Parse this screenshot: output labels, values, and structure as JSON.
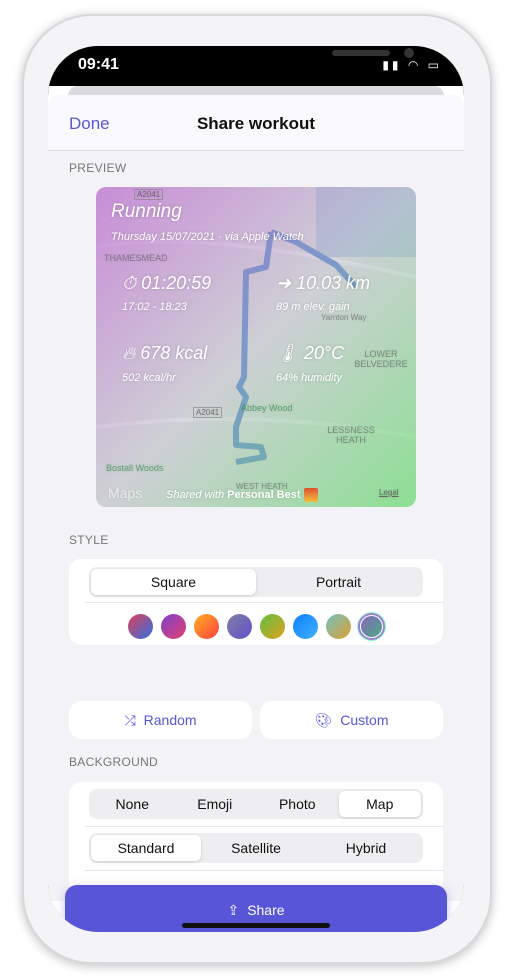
{
  "status": {
    "time": "09:41"
  },
  "nav": {
    "done": "Done",
    "title": "Share workout"
  },
  "sections": {
    "preview": "PREVIEW",
    "style": "STYLE",
    "background": "BACKGROUND"
  },
  "preview": {
    "activity": "Running",
    "subtitle": "Thursday 15/07/2021 · via Apple Watch",
    "duration": "01:20:59",
    "time_range": "17:02 - 18:23",
    "distance": "10.03 km",
    "elevation": "89 m elev. gain",
    "calories": "678 kcal",
    "cal_rate": "502 kcal/hr",
    "temperature": "20°C",
    "humidity": "64% humidity",
    "shared_prefix": "Shared with",
    "shared_app": "Personal Best",
    "maps": "Maps",
    "legal": "Legal",
    "map_labels": [
      "A2041",
      "THAMESMEAD",
      "Yarnton Way",
      "LOWER BELVEDERE",
      "Abbey Wood",
      "A2041",
      "LESSNESS HEATH",
      "Bostall Woods",
      "WEST HEATH"
    ]
  },
  "style": {
    "options": [
      "Square",
      "Portrait"
    ],
    "selected": "Square",
    "swatches": [
      [
        "#e0405a",
        "#3070e0"
      ],
      [
        "#8040d0",
        "#e04070"
      ],
      [
        "#ffb020",
        "#ff4040"
      ],
      [
        "#8080a0",
        "#6050d0"
      ],
      [
        "#60c040",
        "#e0a020"
      ],
      [
        "#1080ff",
        "#40b0ff"
      ],
      [
        "#70c0c0",
        "#e0a030"
      ],
      [
        "#9060c0",
        "#40b080"
      ]
    ],
    "selected_swatch": 7,
    "random": "Random",
    "custom": "Custom"
  },
  "background": {
    "types": [
      "None",
      "Emoji",
      "Photo",
      "Map"
    ],
    "selected_type": "Map",
    "map_types": [
      "Standard",
      "Satellite",
      "Hybrid"
    ],
    "selected_map": "Standard"
  },
  "share": "Share",
  "colors": {
    "accent": "#5856d6"
  }
}
